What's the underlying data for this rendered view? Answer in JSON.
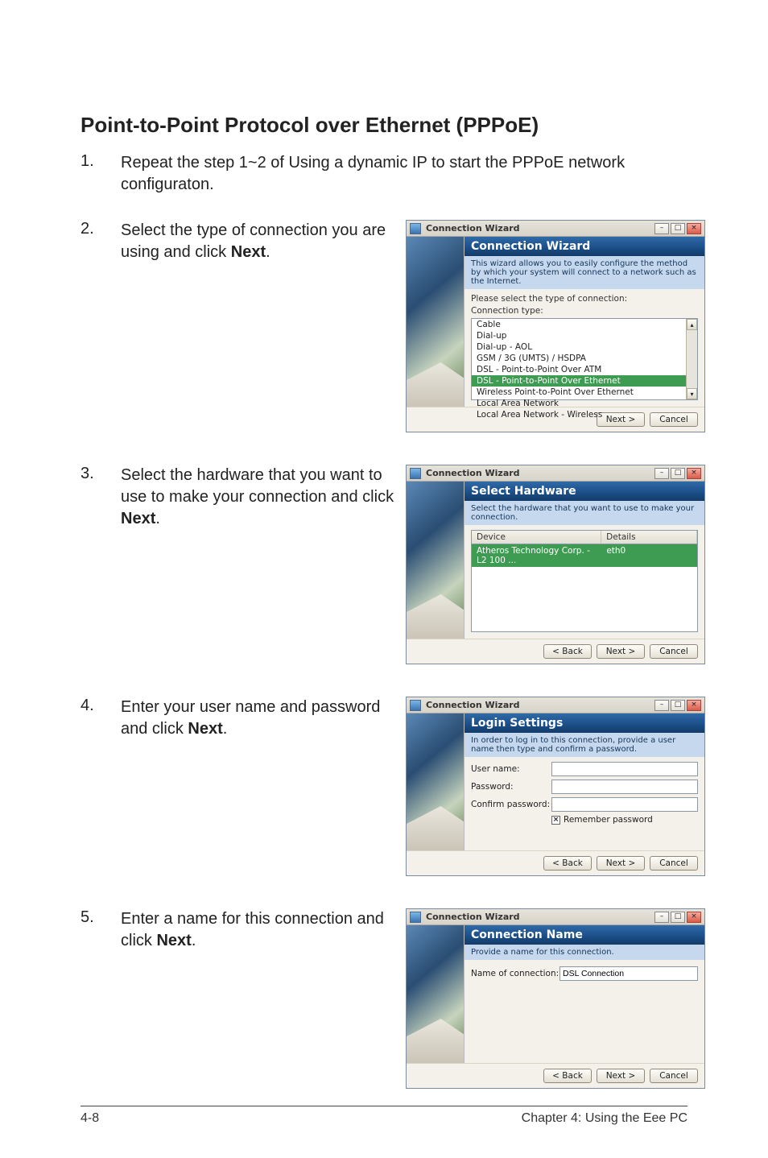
{
  "heading": "Point-to-Point Protocol over Ethernet (PPPoE)",
  "steps": {
    "s1": {
      "num": "1.",
      "text_a": "Repeat the step 1~2 of Using a dynamic IP to start the PPPoE network configuraton."
    },
    "s2": {
      "num": "2.",
      "text_a": "Select the type of connection you are using and click ",
      "bold": "Next",
      "text_b": "."
    },
    "s3": {
      "num": "3.",
      "text_a": "Select the hardware that you want to use to make your connection and click ",
      "bold": "Next",
      "text_b": "."
    },
    "s4": {
      "num": "4.",
      "text_a": "Enter your user name and password and click ",
      "bold": "Next",
      "text_b": "."
    },
    "s5": {
      "num": "5.",
      "text_a": "Enter a name for this connection and click ",
      "bold": "Next",
      "text_b": "."
    }
  },
  "dlg": {
    "title": "Connection Wizard",
    "btn_back": "< Back",
    "btn_next": "Next >",
    "btn_cancel": "Cancel",
    "d1": {
      "header": "Connection Wizard",
      "sub": "This wizard allows you to easily configure the method by which your system will connect to a network such as the Internet.",
      "prompt": "Please select the type of connection:",
      "type_label": "Connection type:",
      "items": [
        "Cable",
        "Dial-up",
        "Dial-up - AOL",
        "GSM / 3G (UMTS) / HSDPA",
        "DSL - Point-to-Point Over ATM",
        "DSL - Point-to-Point Over Ethernet",
        "Wireless Point-to-Point Over Ethernet",
        "Local Area Network",
        "Local Area Network - Wireless"
      ]
    },
    "d2": {
      "header": "Select Hardware",
      "sub": "Select the hardware that you want to use to make your connection.",
      "col_device": "Device",
      "col_details": "Details",
      "row_device": "Atheros Technology Corp. - L2 100 ...",
      "row_details": "eth0"
    },
    "d3": {
      "header": "Login Settings",
      "sub": "In order to log in to this connection, provide a user name then type and confirm a password.",
      "user": "User name:",
      "pass": "Password:",
      "confirm": "Confirm password:",
      "remember": "Remember password"
    },
    "d4": {
      "header": "Connection Name",
      "sub": "Provide a name for this connection.",
      "name_label": "Name of connection:",
      "name_value": "DSL Connection"
    }
  },
  "footer": {
    "left": "4-8",
    "right": "Chapter 4: Using the Eee PC"
  }
}
